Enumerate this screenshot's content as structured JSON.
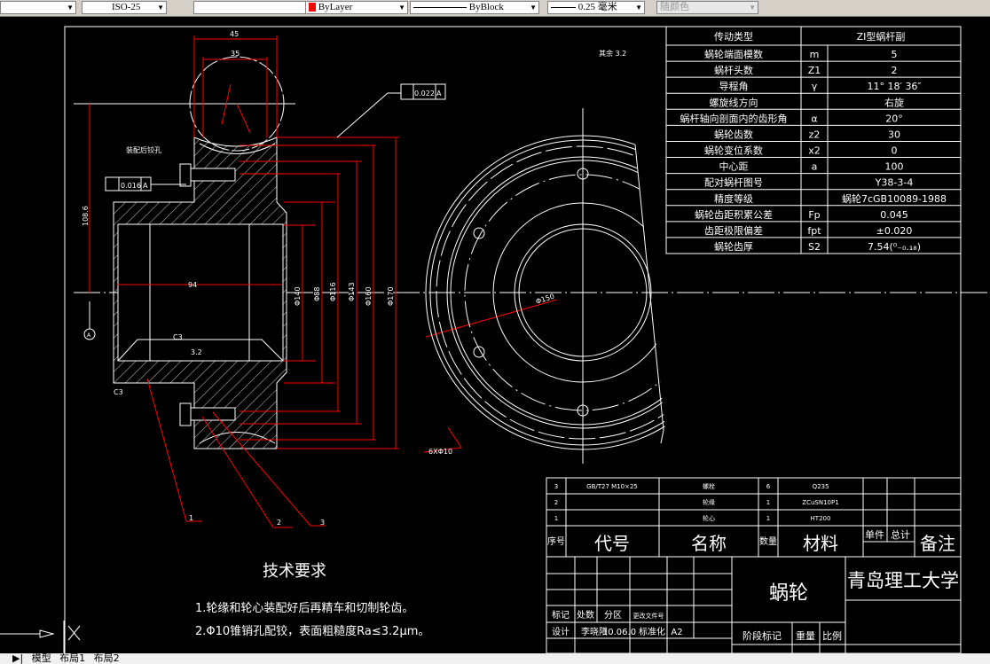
{
  "toolbar": {
    "dimstyle": "ISO-25",
    "color": "ByLayer",
    "linetype": "ByBlock",
    "lineweight": "0.25 毫米",
    "plotstyle": "随颜色",
    "color_swatch": "#ff0000"
  },
  "params_table": {
    "header": [
      "传动类型",
      "ZI型蜗杆副"
    ],
    "rows": [
      {
        "label": "蜗轮端面模数",
        "symbol": "m",
        "value": "5"
      },
      {
        "label": "蜗杆头数",
        "symbol": "Z1",
        "value": "2"
      },
      {
        "label": "导程角",
        "symbol": "γ",
        "value": "11° 18′ 36″"
      },
      {
        "label": "螺旋线方向",
        "symbol": "",
        "value": "右旋"
      },
      {
        "label": "蜗杆轴向剖面内的齿形角",
        "symbol": "α",
        "value": "20°"
      },
      {
        "label": "蜗轮齿数",
        "symbol": "z2",
        "value": "30"
      },
      {
        "label": "蜗轮变位系数",
        "symbol": "x2",
        "value": "0"
      },
      {
        "label": "中心距",
        "symbol": "a",
        "value": "100"
      },
      {
        "label": "配对蜗杆图号",
        "symbol": "",
        "value": "Y38-3-4"
      },
      {
        "label": "精度等级",
        "symbol": "",
        "value": "蜗轮7cGB10089-1988"
      },
      {
        "label": "蜗轮齿距积累公差",
        "symbol": "Fp",
        "value": "0.045"
      },
      {
        "label": "齿距极限偏差",
        "symbol": "fpt",
        "value": "±0.020"
      },
      {
        "label": "蜗轮齿厚",
        "symbol": "S2",
        "value": "7.54(⁰₋₀.₁₈)"
      }
    ]
  },
  "parts_list": {
    "rows": [
      {
        "no": "3",
        "code": "GB/T27 M10×25",
        "name": "螺栓",
        "qty": "6",
        "material": "Q235"
      },
      {
        "no": "2",
        "code": "",
        "name": "轮缘",
        "qty": "1",
        "material": "ZCuSN10P1"
      },
      {
        "no": "1",
        "code": "",
        "name": "轮心",
        "qty": "1",
        "material": "HT200"
      }
    ],
    "header": {
      "no": "序号",
      "code": "代号",
      "name": "名称",
      "qty": "数量",
      "material": "材料",
      "unit": "单件",
      "total": "总计",
      "remark": "备注"
    }
  },
  "title_block": {
    "part_name": "蜗轮",
    "school": "青岛理工大学",
    "labels": {
      "mark": "标记",
      "count": "处数",
      "zone": "分区",
      "doc": "更改文件号",
      "design": "设计",
      "designer": "李晓阳",
      "date": "10.06.0",
      "std": "标准化",
      "size": "A2",
      "stage": "阶段标记",
      "weight": "重量",
      "scale": "比例"
    }
  },
  "tech_req": {
    "title": "技术要求",
    "items": [
      "1.轮缘和轮心装配好后再精车和切制轮齿。",
      "2.Φ10锥销孔配铰，表面粗糙度Ra≤3.2μm。"
    ]
  },
  "drawing_labels": {
    "w45": "45",
    "w35": "35",
    "d94": "94",
    "c3a": "C3",
    "c3b": "C3",
    "ra": "3.2",
    "tol1": "0.022",
    "tol2": "0.016",
    "datum": "A",
    "datum_mark": "A",
    "note_assembly": "装配后铰孔",
    "rest_ra": "其余 3.2",
    "phi150": "Φ150",
    "holes": "6XΦ10",
    "dims": [
      "Φ140",
      "Φ88",
      "Φ116",
      "Φ143",
      "Φ160",
      "Φ170"
    ],
    "r_dim": "108.6",
    "balloons": [
      "1",
      "2",
      "3"
    ]
  },
  "tabs": [
    "模型",
    "布局1",
    "布局2"
  ]
}
